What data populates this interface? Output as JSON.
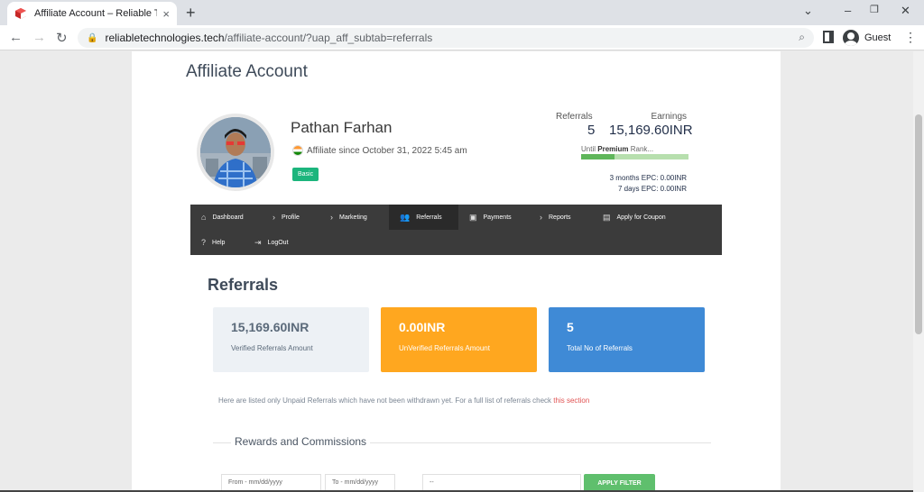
{
  "browser": {
    "tab_title": "Affiliate Account – Reliable Techno",
    "tab_close": "×",
    "new_tab": "+",
    "url_domain": "reliabletechnologies.tech",
    "url_path": "/affiliate-account/?uap_aff_subtab=referrals",
    "profile_label": "Guest",
    "icons": [
      "favicon-cube-icon",
      "close-icon",
      "plus-icon",
      "minimize-icon",
      "restore-icon",
      "window-close-icon",
      "back-icon",
      "forward-icon",
      "reload-icon",
      "lock-icon",
      "zoom-icon",
      "sidepanel-icon",
      "avatar-icon",
      "kebab-menu-icon"
    ]
  },
  "page": {
    "title": "Affiliate Account"
  },
  "profile": {
    "name": "Pathan Farhan",
    "since": "Affiliate since October 31, 2022 5:45 am",
    "badge": "Basic"
  },
  "stats": {
    "referrals_label": "Referrals",
    "earnings_label": "Earnings",
    "referrals_value": "5",
    "earnings_value": "15,169.60INR",
    "rank_prefix": "Until",
    "rank_bold": "Premium",
    "rank_suffix": "Rank...",
    "rank_progress_percent": 31,
    "epc_3m": "3 months EPC: 0.00INR",
    "epc_7d": "7 days EPC: 0.00INR"
  },
  "menu": {
    "dashboard": "Dashboard",
    "profile": "Profile",
    "marketing": "Marketing",
    "referrals": "Referrals",
    "payments": "Payments",
    "reports": "Reports",
    "coupon": "Apply for Coupon",
    "help": "Help",
    "logout": "LogOut"
  },
  "section": {
    "title": "Referrals"
  },
  "cards": [
    {
      "value": "15,169.60INR",
      "label": "Verified Referrals Amount"
    },
    {
      "value": "0.00INR",
      "label": "UnVerified Referrals Amount"
    },
    {
      "value": "5",
      "label": "Total No of Referrals"
    }
  ],
  "note": {
    "text": "Here are listed only Unpaid Referrals which have not been withdrawn yet. For a full list of referrals check ",
    "link": "this section"
  },
  "rewards": {
    "title": "Rewards and Commissions"
  },
  "filter": {
    "from_placeholder": "From - mm/dd/yyyy",
    "to_placeholder": "To - mm/dd/yyyy",
    "select_value": "--",
    "button": "APPLY FILTER"
  },
  "colors": {
    "verified_card": "#edf1f5",
    "unverified_card": "#ffa71f",
    "total_card": "#3f8ad6",
    "badge": "#1cb57d",
    "menubar": "#3b3b3b"
  }
}
